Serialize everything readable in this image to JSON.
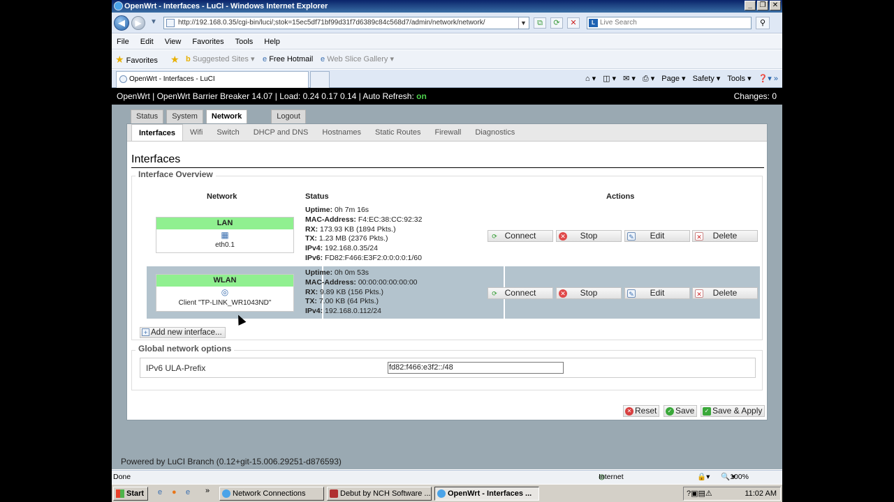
{
  "window": {
    "title": "OpenWrt - Interfaces - LuCI - Windows Internet Explorer",
    "url": "http://192.168.0.35/cgi-bin/luci/;stok=15ec5df71bf99d31f7d6389c84c568d7/admin/network/network/",
    "search_placeholder": "Live Search"
  },
  "menu": [
    "File",
    "Edit",
    "View",
    "Favorites",
    "Tools",
    "Help"
  ],
  "favorites": {
    "label": "Favorites",
    "items": [
      "Suggested Sites ▾",
      "Free Hotmail",
      "Web Slice Gallery ▾"
    ]
  },
  "tab": {
    "title": "OpenWrt - Interfaces - LuCI"
  },
  "commands": [
    "Page ▾",
    "Safety ▾",
    "Tools ▾"
  ],
  "luci": {
    "header_text": "OpenWrt | OpenWrt Barrier Breaker 14.07 | Load: 0.24 0.17 0.14 | Auto Refresh: ",
    "auto_refresh": "on",
    "changes": "Changes: 0",
    "main_tabs": [
      "Status",
      "System",
      "Network",
      "Logout"
    ],
    "sub_tabs": [
      "Interfaces",
      "Wifi",
      "Switch",
      "DHCP and DNS",
      "Hostnames",
      "Static Routes",
      "Firewall",
      "Diagnostics"
    ],
    "page_title": "Interfaces",
    "overview_legend": "Interface Overview",
    "col_network": "Network",
    "col_status": "Status",
    "col_actions": "Actions",
    "lan": {
      "name": "LAN",
      "device": "eth0.1",
      "uptime_label": "Uptime:",
      "uptime": " 0h 7m 16s",
      "mac_label": "MAC-Address:",
      "mac": " F4:EC:38:CC:92:32",
      "rx_label": "RX:",
      "rx": " 173.93 KB (1894 Pkts.)",
      "tx_label": "TX:",
      "tx": " 1.23 MB (2376 Pkts.)",
      "ipv4_label": "IPv4:",
      "ipv4": " 192.168.0.35/24",
      "ipv6_label": "IPv6:",
      "ipv6": " FD82:F466:E3F2:0:0:0:0:1/60"
    },
    "wlan": {
      "name": "WLAN",
      "device": "Client \"TP-LINK_WR1043ND\"",
      "uptime_label": "Uptime:",
      "uptime": " 0h 0m 53s",
      "mac_label": "MAC-Address:",
      "mac": " 00:00:00:00:00:00",
      "rx_label": "RX:",
      "rx": " 9.89 KB (156 Pkts.)",
      "tx_label": "TX:",
      "tx": " 7.00 KB (64 Pkts.)",
      "ipv4_label": "IPv4:",
      "ipv4": " 192.168.0.112/24"
    },
    "actions": {
      "connect": "Connect",
      "stop": "Stop",
      "edit": "Edit",
      "delete": "Delete"
    },
    "add_interface": "Add new interface...",
    "global_legend": "Global network options",
    "ula_label": "IPv6 ULA-Prefix",
    "ula_value": "fd82:f466:e3f2::/48",
    "reset": "Reset",
    "save": "Save",
    "save_apply": "Save & Apply",
    "powered": "Powered by LuCI Branch (0.12+git-15.006.29251-d876593)"
  },
  "statusbar": {
    "left": "Done",
    "zone": "Internet",
    "zoom": "100%"
  },
  "taskbar": {
    "start": "Start",
    "tasks": [
      "Network Connections",
      "Debut by NCH Software ...",
      "OpenWrt - Interfaces ..."
    ],
    "clock": "11:02 AM"
  },
  "colors": {
    "lan_green": "#90f090",
    "row_alt": "#b3c3cd",
    "header_bg": "#000000",
    "on_green": "#4dd04d"
  }
}
